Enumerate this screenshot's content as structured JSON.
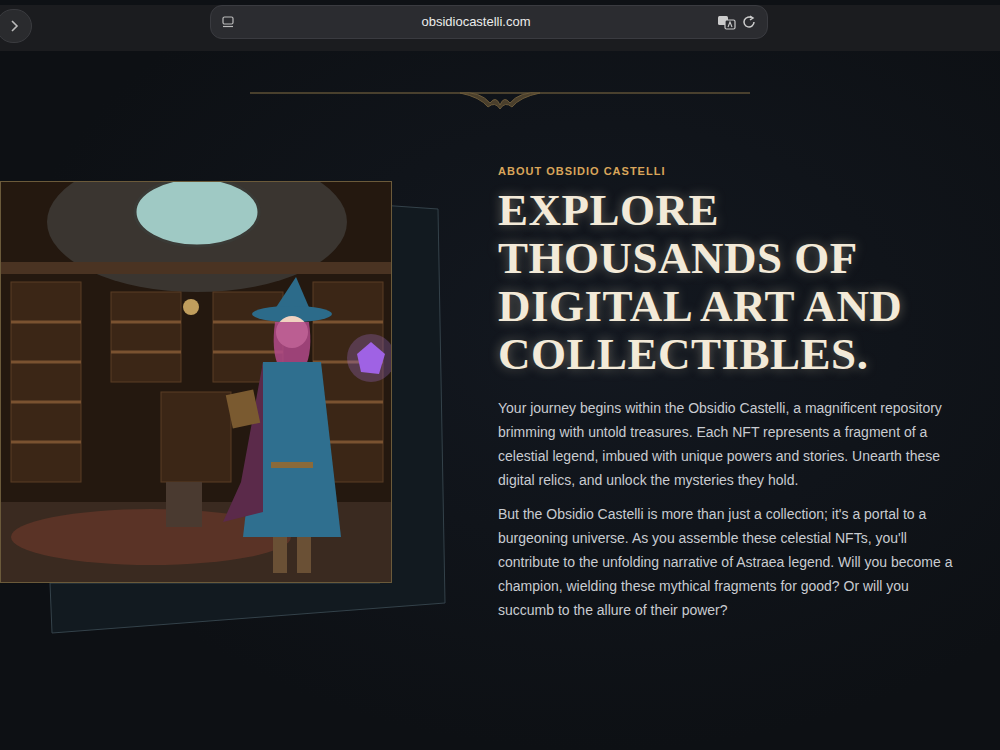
{
  "browser": {
    "address": "obsidiocastelli.com"
  },
  "about": {
    "eyebrow": "ABOUT OBSIDIO CASTELLI",
    "heading": "EXPLORE THOUSANDS OF DIGITAL ART AND COLLECTIBLES.",
    "paragraphs": [
      "Your journey begins within the Obsidio Castelli, a magnificent repository brimming with untold treasures. Each NFT represents a fragment of a celestial legend, imbued with unique powers and stories. Unearth these digital relics, and unlock the mysteries they hold.",
      "But the Obsidio Castelli is more than just a collection; it's a portal to a burgeoning universe. As you assemble these celestial NFTs, you'll contribute to the unfolding narrative of Astraea legend. Will you become a champion, wielding these mythical fragments for good? Or will you succumb to the allure of their power?"
    ]
  }
}
